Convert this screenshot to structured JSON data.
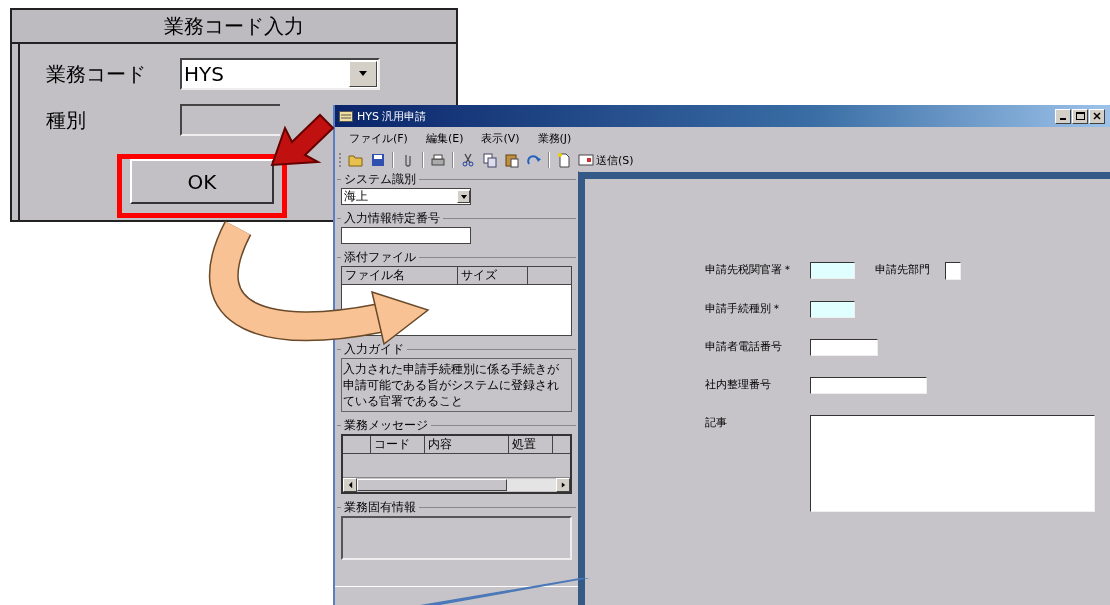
{
  "dialog": {
    "title": "業務コード入力",
    "fields": [
      {
        "label": "業務コード",
        "kind": "combo",
        "value": "HYS",
        "disabled": false
      },
      {
        "label": "種別",
        "kind": "text",
        "disabled": true
      }
    ],
    "ok_button": "OK"
  },
  "main_window": {
    "title": "HYS 汎用申請",
    "menu": [
      "ファイル(F)",
      "編集(E)",
      "表示(V)",
      "業務(J)"
    ],
    "toolbar": {
      "send_button": "送信(S)"
    },
    "left_panel": {
      "system": {
        "label": "システム識別",
        "value": "海上"
      },
      "input_id": {
        "label": "入力情報特定番号"
      },
      "attachments": {
        "label": "添付ファイル",
        "columns": [
          "ファイル名",
          "サイズ"
        ]
      },
      "guide": {
        "label": "入力ガイド",
        "text": "入力された申請手続種別に係る手続きが申請可能である旨がシステムに登録されている官署であること"
      },
      "messages": {
        "label": "業務メッセージ",
        "columns": [
          "コード",
          "内容",
          "処置"
        ]
      },
      "specific_info": {
        "label": "業務固有情報"
      }
    }
  },
  "zoom_panel": {
    "rows": [
      {
        "fields": [
          {
            "label": "申請先税関官署＊",
            "kind": "short",
            "required": true
          },
          {
            "label": "申請先部門",
            "kind": "tiny",
            "required": false
          }
        ]
      },
      {
        "fields": [
          {
            "label": "申請手続種別＊",
            "kind": "short",
            "required": true
          }
        ]
      },
      {
        "fields": [
          {
            "label": "申請者電話番号",
            "kind": "medium",
            "required": false
          }
        ]
      },
      {
        "fields": [
          {
            "label": "社内整理番号",
            "kind": "long",
            "required": false
          }
        ]
      },
      {
        "fields": [
          {
            "label": "記事",
            "kind": "memo",
            "required": false
          }
        ]
      }
    ]
  }
}
